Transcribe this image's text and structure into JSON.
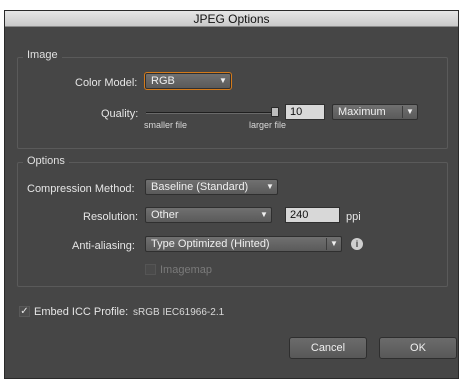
{
  "window": {
    "title": "JPEG Options"
  },
  "image_group": {
    "title": "Image",
    "color_model": {
      "label": "Color Model:",
      "value": "RGB"
    },
    "quality": {
      "label": "Quality:",
      "value": "10",
      "level": "Maximum",
      "smaller_label": "smaller file",
      "larger_label": "larger file",
      "slider_fraction": 1.0
    }
  },
  "options_group": {
    "title": "Options",
    "compression": {
      "label": "Compression Method:",
      "value": "Baseline (Standard)"
    },
    "resolution": {
      "label": "Resolution:",
      "value": "Other",
      "number": "240",
      "unit": "ppi"
    },
    "anti_aliasing": {
      "label": "Anti-aliasing:",
      "value": "Type Optimized (Hinted)"
    },
    "imagemap": {
      "label": "Imagemap",
      "checked": false,
      "enabled": false
    }
  },
  "embed_icc": {
    "label": "Embed ICC Profile:",
    "value": "sRGB IEC61966-2.1",
    "checked": true
  },
  "buttons": {
    "cancel": "Cancel",
    "ok": "OK"
  },
  "icons": {
    "dropdown": "chevron-down-icon",
    "info": "info-icon",
    "check": "checkmark-icon"
  },
  "colors": {
    "focus_ring": "#d47a1a",
    "panel_bg": "#464646"
  }
}
